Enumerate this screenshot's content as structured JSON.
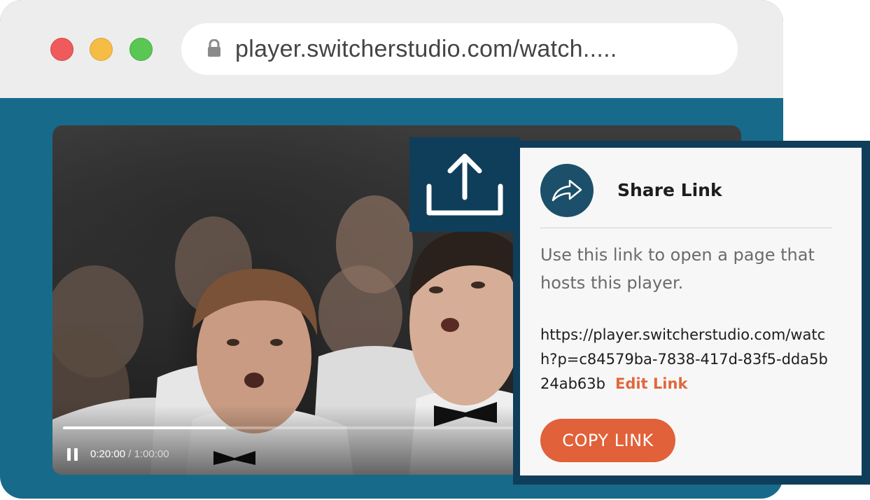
{
  "browser": {
    "url": "player.switcherstudio.com/watch.....",
    "colors": {
      "chrome": "#ededed",
      "page_background": "#176a8a",
      "close": "#ef5b5b",
      "minimize": "#f5bd45",
      "maximize": "#5ac653"
    }
  },
  "player": {
    "progress": 0.333,
    "current_time": "0:20:00",
    "separator": " / ",
    "total_time": "1:00:00",
    "pause_icon": "pause-icon"
  },
  "share": {
    "upload_icon": "share-upload-icon",
    "title": "Share Link",
    "title_icon": "share-arrow-icon",
    "description": "Use this link to open a page that hosts this player.",
    "url": "https://player.switcherstudio.com/watch?p=c84579ba-7838-417d-83f5-dda5b24ab63b",
    "edit_label": "Edit Link",
    "copy_label": "COPY LINK",
    "colors": {
      "accent": "#e1613a",
      "frame": "#0f3e5a"
    }
  }
}
